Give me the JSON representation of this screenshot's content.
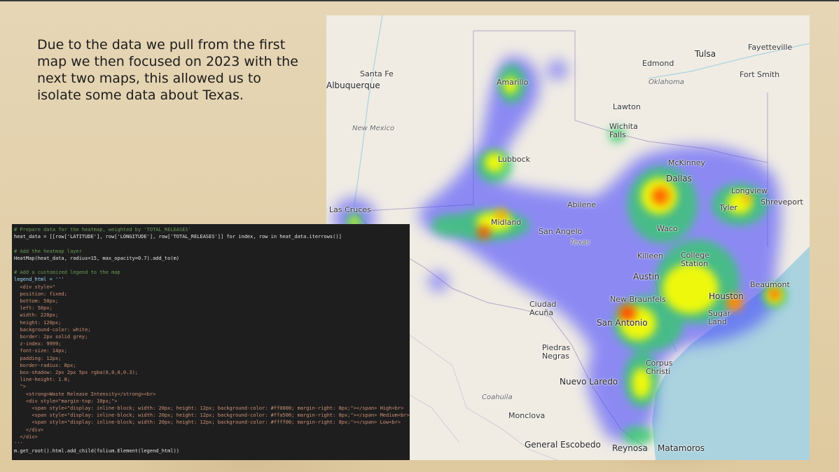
{
  "slide": {
    "intro_text": "Due to the data we pull from the first map we then focused on 2023 with the next two maps, this allowed us to isolate some data about Texas."
  },
  "map": {
    "labels": {
      "tulsa": "Tulsa",
      "fayetteville": "Fayetteville",
      "santa_fe": "Santa Fe",
      "edmond": "Edmond",
      "fort_smith": "Fort Smith",
      "albuquerque": "Albuquerque",
      "oklahoma": "Oklahoma",
      "amarillo": "Amarillo",
      "lawton": "Lawton",
      "new_mexico": "New Mexico",
      "wichita_falls": "Wichita Falls",
      "lubbock": "Lubbock",
      "mckinney": "McKinney",
      "dallas": "Dallas",
      "longview": "Longview",
      "las_cruces": "Las Cruces",
      "abilene": "Abilene",
      "tyler": "Tyler",
      "shreveport": "Shreveport",
      "midland": "Midland",
      "san_angelo": "San Angelo",
      "waco": "Waco",
      "texas": "Texas",
      "killeen": "Killeen",
      "college_station": "College Station",
      "austin": "Austin",
      "beaumont": "Beaumont",
      "houston": "Houston",
      "new_braunfels": "New Braunfels",
      "ciudad_acuna": "Ciudad Acuña",
      "sugar_land": "Sugar Land",
      "san_antonio": "San Antonio",
      "piedras_negras": "Piedras Negras",
      "corpus_christi": "Corpus Christi",
      "nuevo_laredo": "Nuevo Laredo",
      "coahuila": "Coahuila",
      "monclova": "Monclova",
      "general_escobedo": "General Escobedo",
      "reynosa": "Reynosa",
      "matamoros": "Matamoros"
    },
    "colors": {
      "land": "#f0ece4",
      "water": "#aad3df",
      "heat_low": "#ffff00",
      "heat_medium": "#ffa500",
      "heat_high": "#ff0000"
    }
  },
  "code": {
    "lines": [
      {
        "cls": "c-comment",
        "text": "# Prepare data for the heatmap, weighted by 'TOTAL_RELEASES'"
      },
      {
        "cls": "c-white",
        "text": "heat_data = [[row['LATITUDE'], row['LONGITUDE'], row['TOTAL_RELEASES']] for index, row in heat_data.iterrows()]"
      },
      {
        "cls": "c-white",
        "text": ""
      },
      {
        "cls": "c-comment",
        "text": "# Add the heatmap layer"
      },
      {
        "cls": "c-white",
        "text": "HeatMap(heat_data, radius=15, max_opacity=0.7).add_to(m)"
      },
      {
        "cls": "c-white",
        "text": ""
      },
      {
        "cls": "c-comment",
        "text": "# Add a customized legend to the map"
      },
      {
        "cls": "c-var",
        "text": "legend_html = '''"
      },
      {
        "cls": "c-str",
        "text": "  <div style=\""
      },
      {
        "cls": "c-str",
        "text": "  position: fixed;"
      },
      {
        "cls": "c-str",
        "text": "  bottom: 50px;"
      },
      {
        "cls": "c-str",
        "text": "  left: 50px;"
      },
      {
        "cls": "c-str",
        "text": "  width: 220px;"
      },
      {
        "cls": "c-str",
        "text": "  height: 120px;"
      },
      {
        "cls": "c-str",
        "text": "  background-color: white;"
      },
      {
        "cls": "c-str",
        "text": "  border: 2px solid grey;"
      },
      {
        "cls": "c-str",
        "text": "  z-index: 9999;"
      },
      {
        "cls": "c-str",
        "text": "  font-size: 14px;"
      },
      {
        "cls": "c-str",
        "text": "  padding: 12px;"
      },
      {
        "cls": "c-str",
        "text": "  border-radius: 8px;"
      },
      {
        "cls": "c-str",
        "text": "  box-shadow: 2px 2px 5px rgba(0,0,0,0.3);"
      },
      {
        "cls": "c-str",
        "text": "  line-height: 1.8;"
      },
      {
        "cls": "c-str",
        "text": "  \">"
      },
      {
        "cls": "c-str",
        "text": "    <strong>Waste Release Intensity</strong><br>"
      },
      {
        "cls": "c-str",
        "text": "    <div style=\"margin-top: 10px;\">"
      },
      {
        "cls": "c-str",
        "text": "      <span style=\"display: inline-block; width: 20px; height: 12px; background-color: #ff0000; margin-right: 8px;\"></span> High<br>"
      },
      {
        "cls": "c-str",
        "text": "      <span style=\"display: inline-block; width: 20px; height: 12px; background-color: #ffa500; margin-right: 8px;\"></span> Medium<br>"
      },
      {
        "cls": "c-str",
        "text": "      <span style=\"display: inline-block; width: 20px; height: 12px; background-color: #ffff00; margin-right: 8px;\"></span> Low<br>"
      },
      {
        "cls": "c-str",
        "text": "    </div>"
      },
      {
        "cls": "c-str",
        "text": "  </div>"
      },
      {
        "cls": "c-str",
        "text": "'''"
      },
      {
        "cls": "c-white",
        "text": "m.get_root().html.add_child(folium.Element(legend_html))"
      }
    ]
  }
}
